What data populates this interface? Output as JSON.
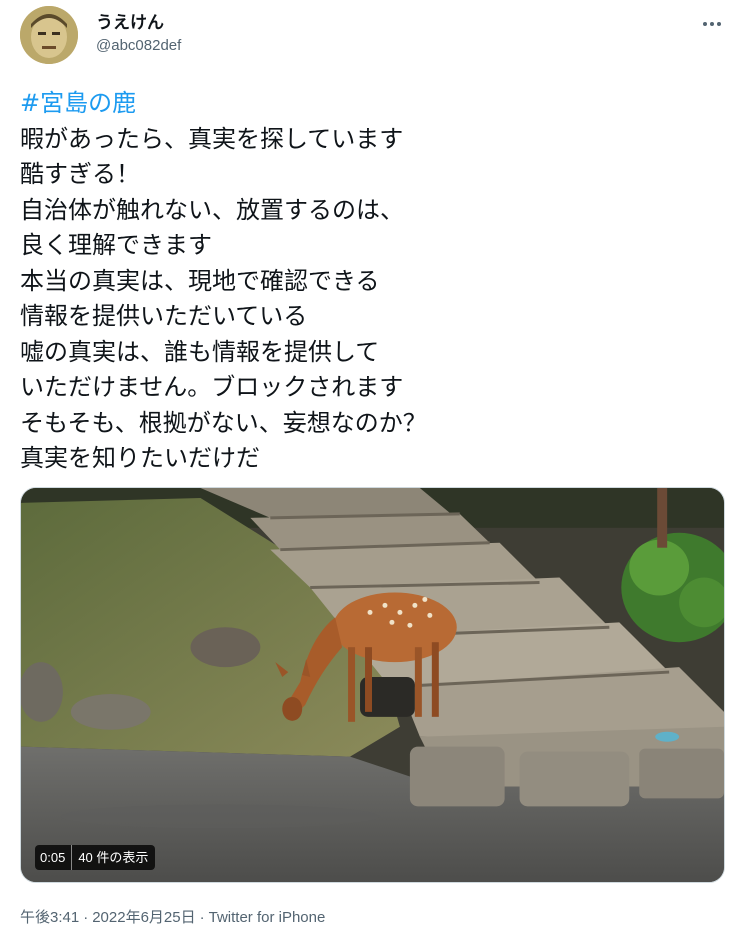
{
  "author": {
    "display_name": "うえけん",
    "handle": "@abc082def"
  },
  "tweet": {
    "hashtag": "#宮島の鹿",
    "lines": [
      "暇があったら、真実を探しています",
      "酷すぎる！",
      "自治体が触れない、放置するのは、",
      "良く理解できます",
      "本当の真実は、現地で確認できる",
      "情報を提供いただいている",
      "嘘の真実は、誰も情報を提供して",
      "いただけません。ブロックされます",
      "そもそも、根拠がない、妄想なのか？",
      "真実を知りたいだけだ"
    ]
  },
  "media": {
    "duration": "0:05",
    "views": "40 件の表示"
  },
  "meta": {
    "time": "午後3:41",
    "date": "2022年6月25日",
    "separator": "·",
    "source": "Twitter for iPhone"
  },
  "colors": {
    "link": "#1d9bf0",
    "secondary_text": "#536471",
    "primary_text": "#0f1419"
  },
  "icons": {
    "more": "more-horizontal-icon"
  }
}
